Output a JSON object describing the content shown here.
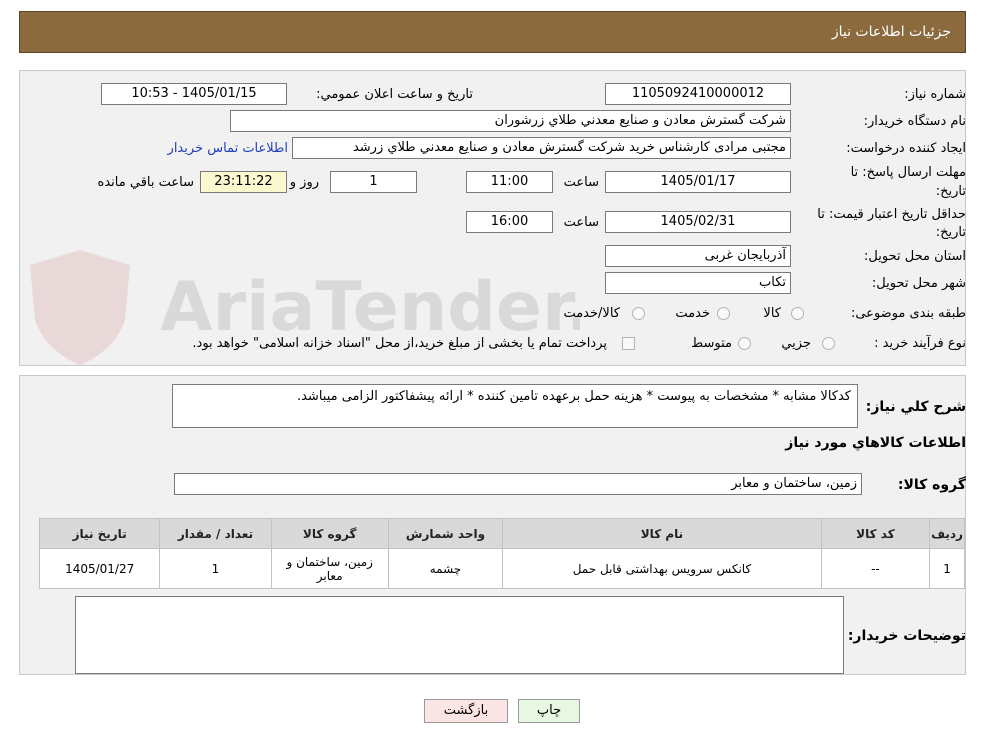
{
  "header": {
    "title": "جزئیات اطلاعات نیاز"
  },
  "fields": {
    "need_number_label": "شماره نیاز:",
    "need_number": "1105092410000012",
    "announce_label": "تاریخ و ساعت اعلان عمومي:",
    "announce_value": "1405/01/15 - 10:53",
    "buyer_org_label": "نام دستگاه خريدار:",
    "buyer_org": "شرکت گسترش معادن و صنايع معدني طلاي زرشوران",
    "creator_label": "ايجاد کننده درخواست:",
    "creator": "مجتبی مرادی کارشناس خرید شرکت گسترش معادن و صنايع معدني طلاي زرشد",
    "contact_link": "اطلاعات تماس خريدار",
    "deadline_label_1": "مهلت ارسال پاسخ: تا",
    "deadline_label_2": "تاريخ:",
    "deadline_date": "1405/01/17",
    "time_label": "ساعت",
    "deadline_time": "11:00",
    "days_value": "1",
    "days_label": "روز و",
    "remaining_time": "23:11:22",
    "remaining_label": "ساعت باقي مانده",
    "validity_label_1": "حداقل تاريخ اعتبار قيمت: تا",
    "validity_label_2": "تاريخ:",
    "validity_date": "1405/02/31",
    "validity_time": "16:00",
    "province_label": "استان محل تحويل:",
    "province": "آذربايجان غربی",
    "city_label": "شهر محل تحويل:",
    "city": "تکاب",
    "category_label": "طبقه بندی موضوعی:",
    "category_options": [
      "کالا",
      "خدمت",
      "کالا/خدمت"
    ],
    "process_label": "نوع فرآيند خريد :",
    "process_options": [
      "جزيي",
      "متوسط"
    ],
    "payment_note": "پرداخت تمام يا بخشی از مبلغ خريد،از محل \"اسناد خزانه اسلامی\" خواهد بود."
  },
  "summary": {
    "label": "شرح کلي نياز:",
    "text": "کدکالا مشابه * مشخصات به پیوست * هزینه حمل برعهده تامین کننده * ارائه پیشفاکتور الزامی میباشد."
  },
  "goods": {
    "section_title": "اطلاعات کالاهاي مورد نياز",
    "group_label": "گروه کالا:",
    "group_value": "زمين، ساختمان و معابر",
    "columns": [
      "رديف",
      "کد کالا",
      "نام کالا",
      "واحد شمارش",
      "گروه کالا",
      "تعداد / مقدار",
      "تاريخ نياز"
    ],
    "rows": [
      [
        "1",
        "--",
        "کانکس سرويس بهداشتی قابل حمل",
        "چشمه",
        "زمين، ساختمان و معابر",
        "1",
        "1405/01/27"
      ]
    ]
  },
  "buyer_notes": {
    "label": "توضيحات خريدار:",
    "value": ""
  },
  "buttons": {
    "print": "چاپ",
    "back": "بازگشت"
  },
  "watermark": {
    "text": "AriaTender.neT"
  },
  "colors": {
    "header_bg": "#8b6a3e",
    "link": "#1f3fbf",
    "highlight": "#fbf7cf",
    "print_btn": "#e8f7e1",
    "back_btn": "#fbe4e4"
  }
}
